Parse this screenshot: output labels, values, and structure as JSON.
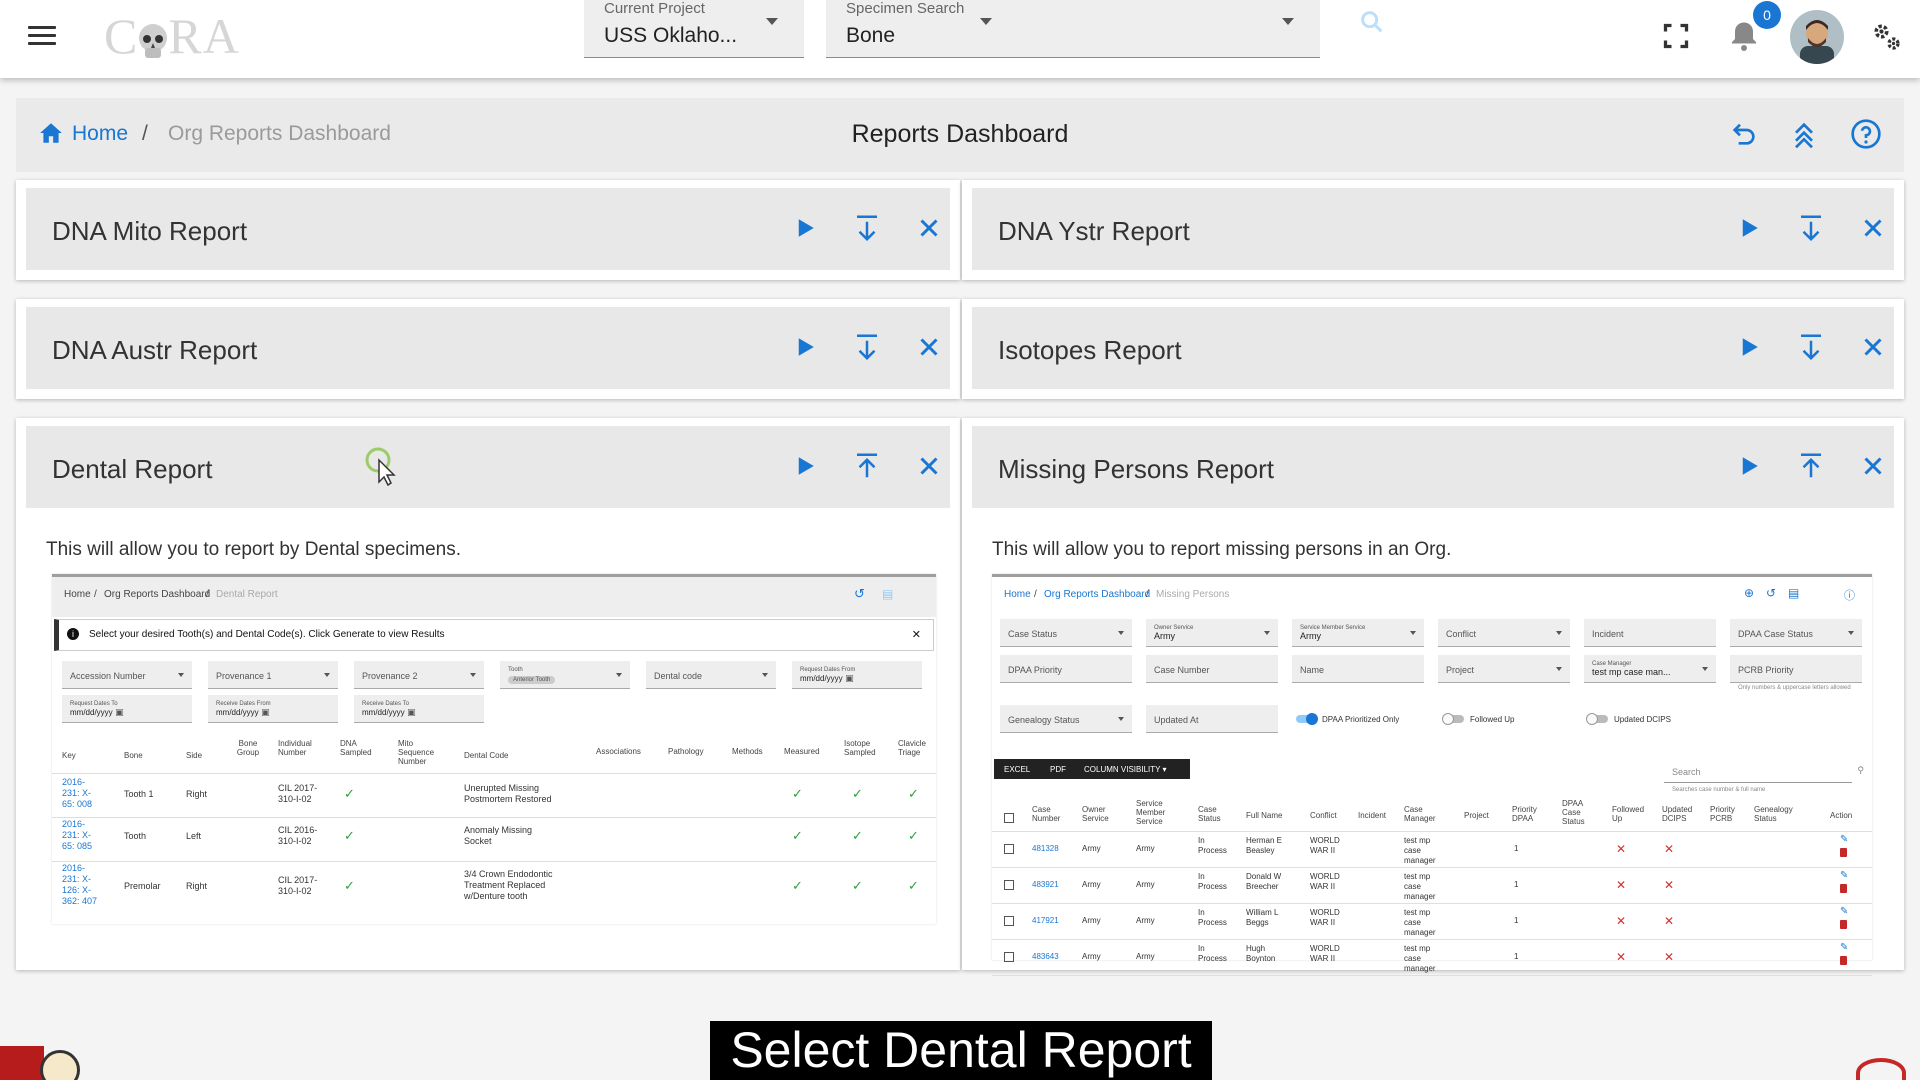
{
  "app": {
    "logo_text_left": "C",
    "logo_text_right": "RA",
    "project": {
      "label": "Current Project",
      "value": "USS Oklaho..."
    },
    "specimen": {
      "label": "Specimen Search",
      "value": "Bone"
    },
    "notifications_count": "0"
  },
  "breadcrumb": {
    "home": "Home",
    "separator": "/",
    "current": "Org Reports Dashboard"
  },
  "page_title": "Reports Dashboard",
  "cards": {
    "mito": {
      "title": "DNA Mito Report"
    },
    "ystr": {
      "title": "DNA Ystr Report"
    },
    "austr": {
      "title": "DNA Austr Report"
    },
    "isotopes": {
      "title": "Isotopes Report"
    },
    "dental": {
      "title": "Dental Report",
      "description": "This will allow you to report by Dental specimens."
    },
    "missing": {
      "title": "Missing Persons Report",
      "description": "This will allow you to report missing persons in an Org."
    }
  },
  "dental_preview": {
    "crumb_home": "Home",
    "crumb_mid": "Org Reports Dashboard",
    "crumb_cur": "Dental Report",
    "alert": "Select your desired Tooth(s) and Dental Code(s). Click Generate to view Results",
    "fields": [
      "Accession Number",
      "Provenance 1",
      "Provenance 2",
      "Tooth",
      "Dental code",
      "Request Dates From",
      "Request Dates To",
      "Receive Dates From",
      "Receive Dates To"
    ],
    "tooth_chip": "Anterior Tooth",
    "date_placeholder": "mm/dd/yyyy",
    "headers": [
      "Key",
      "Bone",
      "Side",
      "Bone Group",
      "Individual Number",
      "DNA Sampled",
      "Mito Sequence Number",
      "Dental Code",
      "Associations",
      "Pathology",
      "Methods",
      "Measured",
      "Isotope Sampled",
      "Clavicle Triage"
    ],
    "rows": [
      {
        "key": "2016-231: X-65: 008",
        "bone": "Tooth 1",
        "side": "Right",
        "individual": "CIL 2017-310-I-02",
        "dental": "Unerupted  Missing Postmortem  Restored"
      },
      {
        "key": "2016-231: X-65: 085",
        "bone": "Tooth",
        "side": "Left",
        "individual": "CIL 2016-310-I-02",
        "dental": "Anomaly  Missing Socket"
      },
      {
        "key": "2016-231: X-126: X-362: 407",
        "bone": "Premolar",
        "side": "Right",
        "individual": "CIL 2017-310-I-02",
        "dental": "3/4 Crown  Endodontic Treatment  Replaced w/Denture tooth"
      }
    ]
  },
  "missing_preview": {
    "crumb_home": "Home",
    "crumb_mid": "Org Reports Dashboard",
    "crumb_cur": "Missing Persons",
    "fields_row1": [
      "Case Status",
      "Owner Service",
      "Service Member Service",
      "Conflict",
      "Incident",
      "DPAA Case Status"
    ],
    "owner_value": "Army",
    "smservice_value": "Army",
    "fields_row2": [
      "DPAA Priority",
      "Case Number",
      "Name",
      "Project",
      "Case Manager",
      "PCRB Priority"
    ],
    "case_manager_value": "test mp case man...",
    "pcrb_hint": "Only numbers & uppercase letters allowed",
    "genealogy": "Genealogy Status",
    "updated_at": "Updated At",
    "toggles": [
      "DPAA Prioritized Only",
      "Followed Up",
      "Updated DCIPS"
    ],
    "buttons": [
      "EXCEL",
      "PDF",
      "COLUMN VISIBILITY ▾"
    ],
    "search_placeholder": "Search",
    "search_hint": "Searches case number & full name",
    "headers": [
      "Case Number",
      "Owner Service",
      "Service Member Service",
      "Case Status",
      "Full Name",
      "Conflict",
      "Incident",
      "Case Manager",
      "Project",
      "Priority DPAA",
      "DPAA Case Status",
      "Followed Up",
      "Updated DCIPS",
      "Priority PCRB",
      "Genealogy Status",
      "Action"
    ],
    "rows": [
      {
        "case": "481328",
        "owner": "Army",
        "sms": "Army",
        "status": "In Process",
        "name": "Herman E Beasley",
        "conflict": "WORLD WAR II",
        "manager": "test mp case manager",
        "priority": "1"
      },
      {
        "case": "483921",
        "owner": "Army",
        "sms": "Army",
        "status": "In Process",
        "name": "Donald W Breecher",
        "conflict": "WORLD WAR II",
        "manager": "test mp case manager",
        "priority": "1"
      },
      {
        "case": "417921",
        "owner": "Army",
        "sms": "Army",
        "status": "In Process",
        "name": "William L Beggs",
        "conflict": "WORLD WAR II",
        "manager": "test mp case manager",
        "priority": "1"
      },
      {
        "case": "483643",
        "owner": "Army",
        "sms": "Army",
        "status": "In Process",
        "name": "Hugh Boynton",
        "conflict": "WORLD WAR II",
        "manager": "test mp case manager",
        "priority": "1"
      }
    ]
  },
  "caption": "Select Dental Report",
  "colors": {
    "accent": "#1976d2",
    "check": "#2e9e3e",
    "cross": "#d32f2f"
  }
}
